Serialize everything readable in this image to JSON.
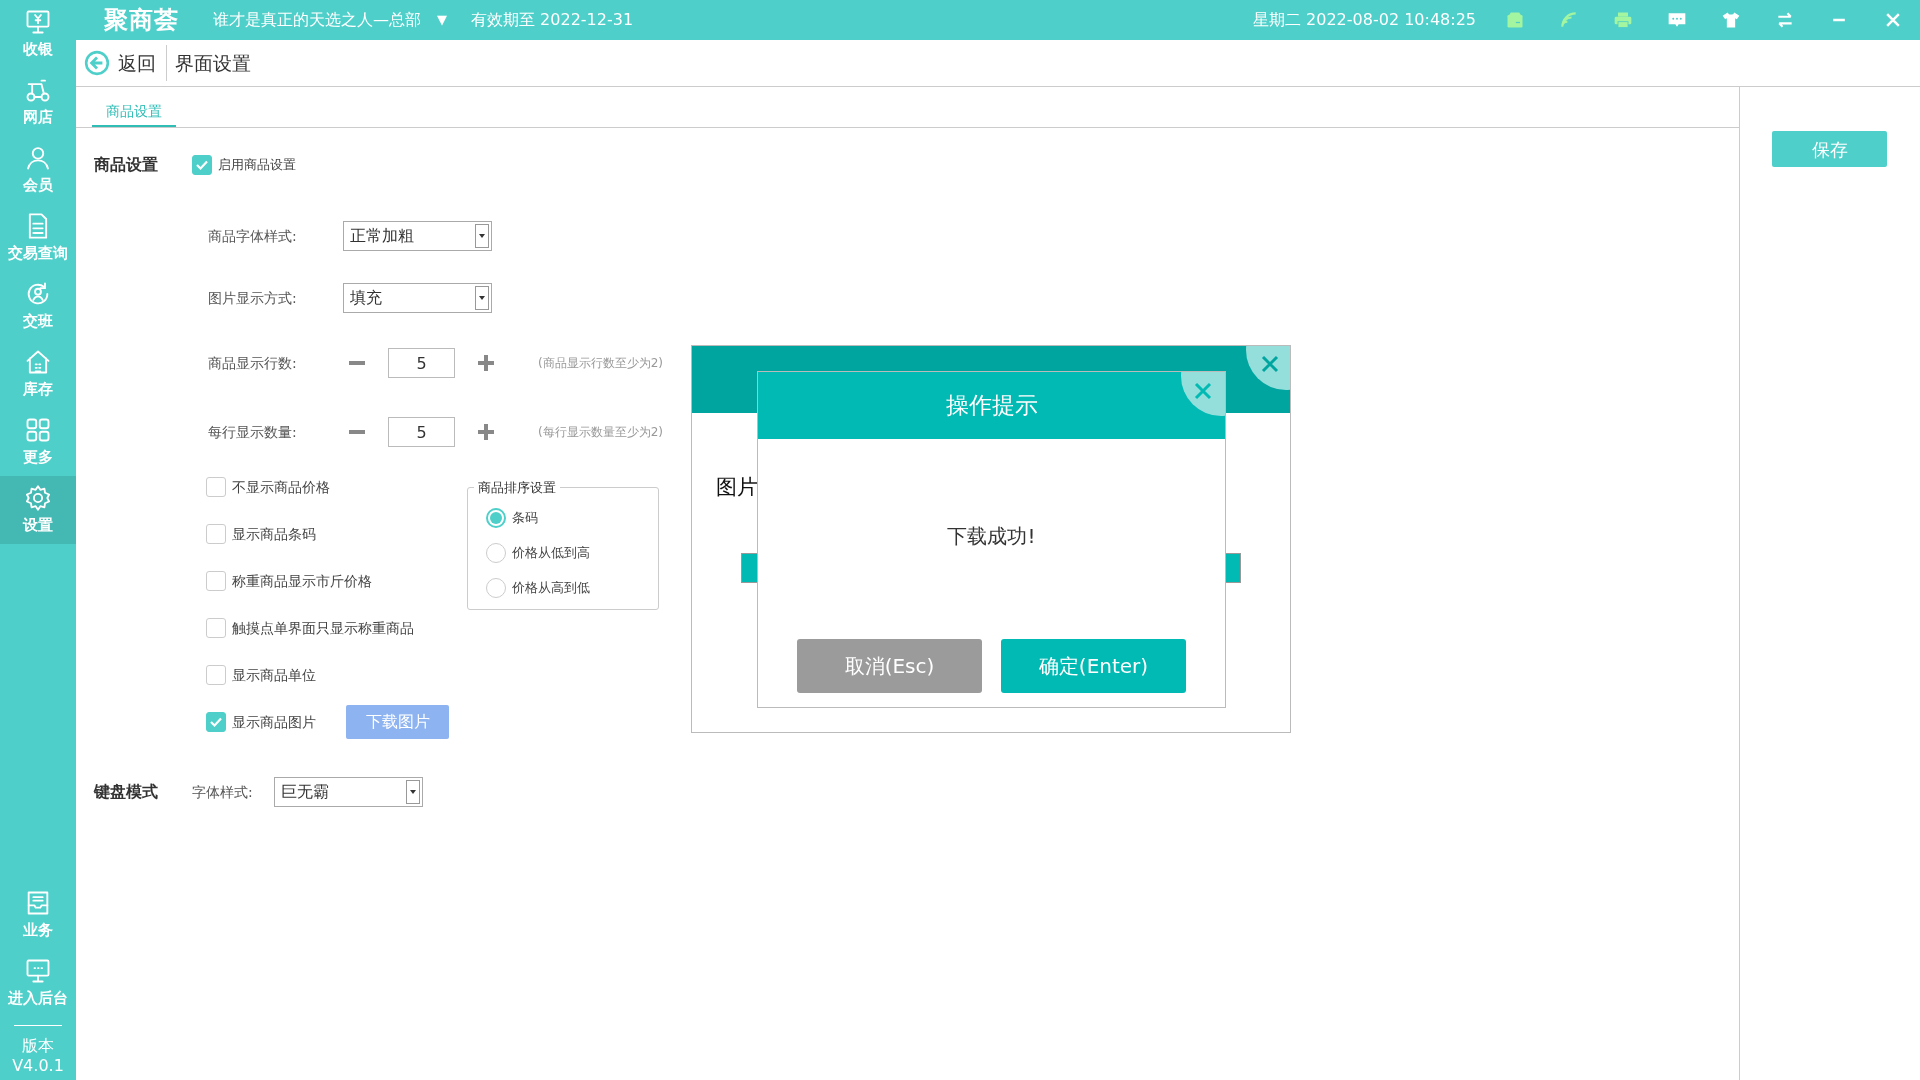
{
  "top_bar": {
    "logo": "聚商荟",
    "store": "谁才是真正的天选之人—总部",
    "store_caret": "▼",
    "expiry": "有效期至 2022-12-31",
    "datetime": "星期二 2022-08-02 10:48:25"
  },
  "sidebar": {
    "items": [
      {
        "label": "收银",
        "selected": false
      },
      {
        "label": "网店",
        "selected": false
      },
      {
        "label": "会员",
        "selected": false
      },
      {
        "label": "交易查询",
        "selected": false
      },
      {
        "label": "交班",
        "selected": false
      },
      {
        "label": "库存",
        "selected": false
      },
      {
        "label": "更多",
        "selected": false
      },
      {
        "label": "设置",
        "selected": true
      }
    ],
    "bottom_items": [
      {
        "label": "业务"
      },
      {
        "label": "进入后台"
      }
    ],
    "version_label": "版本",
    "version": "V4.0.1"
  },
  "header": {
    "back": "返回",
    "title": "界面设置"
  },
  "tabs": [
    {
      "label": "商品设置",
      "selected": true
    }
  ],
  "save_button": "保存",
  "product_settings": {
    "section_label": "商品设置",
    "enable": {
      "label": "启用商品设置",
      "checked": true
    },
    "selects": [
      {
        "label": "商品字体样式:",
        "value": "正常加粗"
      },
      {
        "label": "图片显示方式:",
        "value": "填充"
      }
    ],
    "steppers": [
      {
        "label": "商品显示行数:",
        "value": "5",
        "hint": "(商品显示行数至少为2)"
      },
      {
        "label": "每行显示数量:",
        "value": "5",
        "hint": "(每行显示数量至少为2)"
      }
    ],
    "options": [
      {
        "label": "不显示商品价格",
        "checked": false
      },
      {
        "label": "显示商品条码",
        "checked": false
      },
      {
        "label": "称重商品显示市斤价格",
        "checked": false
      },
      {
        "label": "触摸点单界面只显示称重商品",
        "checked": false
      },
      {
        "label": "显示商品单位",
        "checked": false
      },
      {
        "label": "显示商品图片",
        "checked": true
      }
    ],
    "download_button": "下载图片",
    "sort": {
      "title": "商品排序设置",
      "options": [
        {
          "label": "条码",
          "selected": true
        },
        {
          "label": "价格从低到高",
          "selected": false
        },
        {
          "label": "价格从高到低",
          "selected": false
        }
      ]
    }
  },
  "keyboard_mode": {
    "section_label": "键盘模式",
    "label": "字体样式:",
    "value": "巨无霸"
  },
  "download_dialog": {
    "label": "图片",
    "progress": {
      "level": 1
    }
  },
  "prompt_dialog": {
    "title": "操作提示",
    "message": "下载成功!",
    "cancel": "取消(Esc)",
    "confirm": "确定(Enter)"
  }
}
